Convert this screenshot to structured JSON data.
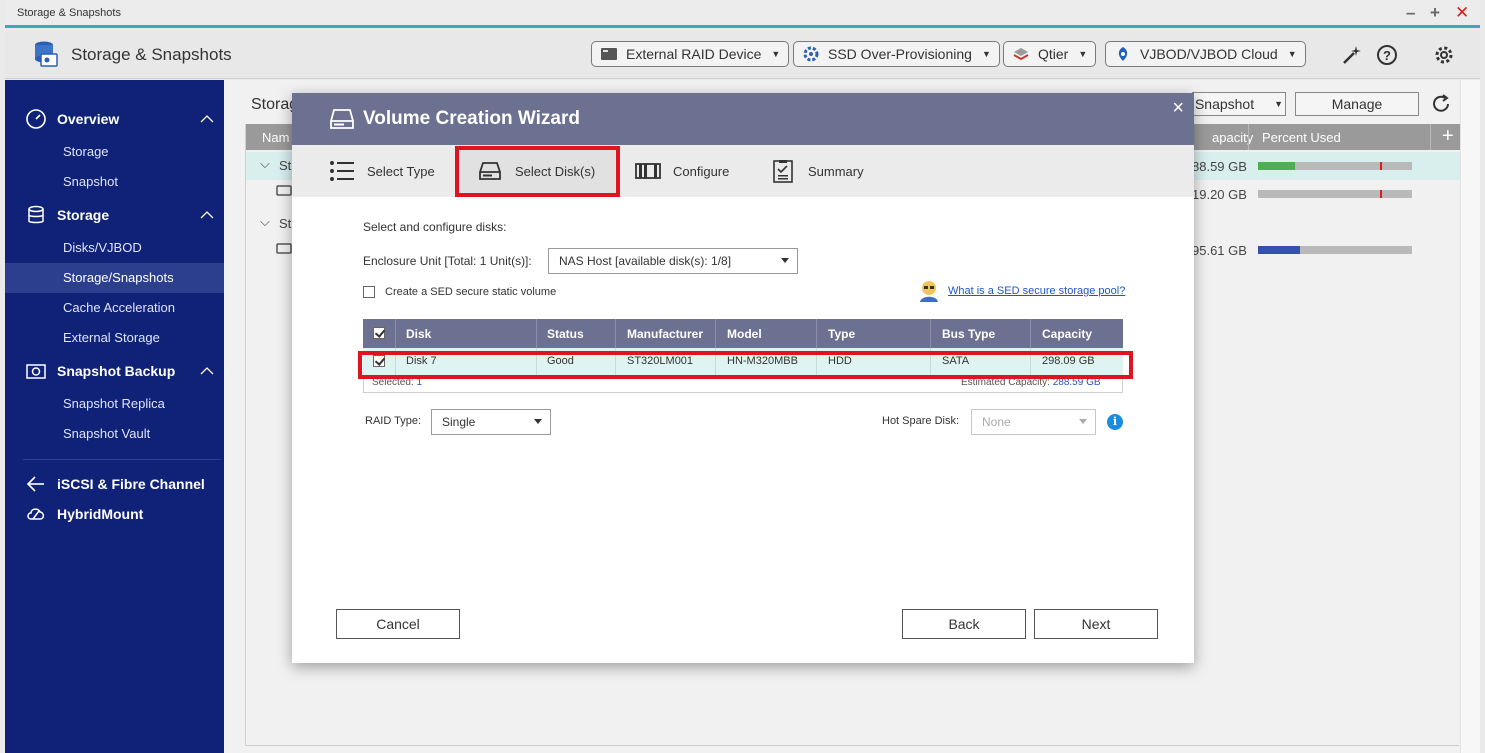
{
  "window": {
    "title": "Storage & Snapshots",
    "controls": [
      "–",
      "+",
      "✕"
    ]
  },
  "header": {
    "app_title": "Storage & Snapshots",
    "buttons": [
      {
        "label": "External RAID Device",
        "icon": "raid-device-icon"
      },
      {
        "label": "SSD Over-Provisioning",
        "icon": "ssd-gear-icon"
      },
      {
        "label": "Qtier",
        "icon": "qtier-layers-icon"
      },
      {
        "label": "VJBOD/VJBOD Cloud",
        "icon": "vjbod-cloud-icon"
      }
    ],
    "icons": [
      "magic-wand-icon",
      "help-icon",
      "settings-gear-icon"
    ]
  },
  "sidebar": {
    "sections": [
      {
        "label": "Overview",
        "icon": "speedometer-icon",
        "items": [
          "Storage",
          "Snapshot"
        ]
      },
      {
        "label": "Storage",
        "icon": "database-icon",
        "items": [
          "Disks/VJBOD",
          "Storage/Snapshots",
          "Cache Acceleration",
          "External Storage"
        ]
      },
      {
        "label": "Snapshot Backup",
        "icon": "camera-icon",
        "items": [
          "Snapshot Replica",
          "Snapshot Vault"
        ]
      }
    ],
    "active_item": "Storage/Snapshots",
    "extra": [
      {
        "label": "iSCSI & Fibre Channel",
        "icon": "iscsi-arrow-icon"
      },
      {
        "label": "HybridMount",
        "icon": "cloud-mount-icon"
      }
    ]
  },
  "background": {
    "page_title_partial": "Storag",
    "column_name_partial": "Nam",
    "column_capacity_partial": "apacity",
    "column_percent_used": "Percent Used",
    "add_column": "+",
    "snapshot_dropdown": "Snapshot",
    "manage_button": "Manage",
    "rows": [
      {
        "name_partial": "St",
        "capacity": "88.59 GB",
        "used_fraction": 0.24,
        "color": "#4caf50"
      },
      {
        "name_partial": "",
        "capacity": "19.20 GB",
        "used_fraction": 0.0,
        "color": "#8a8a8a"
      },
      {
        "name_partial": "St",
        "capacity": "",
        "used_fraction": null,
        "color": ""
      },
      {
        "name_partial": "",
        "capacity": "95.61 GB",
        "used_fraction": 0.27,
        "color": "#3451b2"
      }
    ]
  },
  "modal": {
    "title": "Volume Creation Wizard",
    "close": "×",
    "tabs": [
      {
        "label": "Select Type",
        "icon": "list-icon"
      },
      {
        "label": "Select Disk(s)",
        "icon": "disk-drive-icon",
        "active": true
      },
      {
        "label": "Configure",
        "icon": "configure-icon"
      },
      {
        "label": "Summary",
        "icon": "clipboard-check-icon"
      }
    ],
    "intro": "Select and configure disks:",
    "enclosure_label": "Enclosure Unit [Total: 1 Unit(s)]:",
    "enclosure_value": "NAS Host [available disk(s): 1/8]",
    "sed_checkbox_label": "Create a SED secure static volume",
    "sed_link": "What is a SED secure storage pool?",
    "table": {
      "columns": [
        "Disk",
        "Status",
        "Manufacturer",
        "Model",
        "Type",
        "Bus Type",
        "Capacity"
      ],
      "rows": [
        {
          "checked": true,
          "cells": [
            "Disk 7",
            "Good",
            "ST320LM001",
            "HN-M320MBB",
            "HDD",
            "SATA",
            "298.09 GB"
          ]
        }
      ],
      "footer_selected_label": "Selected:",
      "footer_selected_value": "1",
      "footer_estimated_label": "Estimated Capacity:",
      "footer_estimated_value": "288.59 GB"
    },
    "raid_label": "RAID Type:",
    "raid_value": "Single",
    "hot_spare_label": "Hot Spare Disk:",
    "hot_spare_value": "None",
    "info": "i",
    "buttons": {
      "cancel": "Cancel",
      "back": "Back",
      "next": "Next"
    }
  },
  "colors": {
    "sidebar_bg": "#0f2277",
    "modal_header": "#6d7191",
    "highlight_box": "#e0141f",
    "row_selected": "#dff4f2",
    "link": "#2255c4"
  }
}
